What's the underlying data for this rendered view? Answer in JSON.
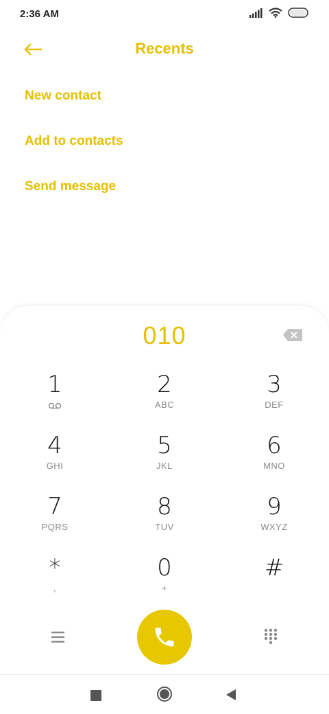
{
  "status_bar": {
    "time": "2:36 AM"
  },
  "header": {
    "title": "Recents"
  },
  "actions": [
    {
      "label": "New contact"
    },
    {
      "label": "Add to contacts"
    },
    {
      "label": "Send message"
    }
  ],
  "dialer": {
    "number": "010",
    "keys": [
      {
        "digit": "1",
        "letters": ""
      },
      {
        "digit": "2",
        "letters": "ABC"
      },
      {
        "digit": "3",
        "letters": "DEF"
      },
      {
        "digit": "4",
        "letters": "GHI"
      },
      {
        "digit": "5",
        "letters": "JKL"
      },
      {
        "digit": "6",
        "letters": "MNO"
      },
      {
        "digit": "7",
        "letters": "PQRS"
      },
      {
        "digit": "8",
        "letters": "TUV"
      },
      {
        "digit": "9",
        "letters": "WXYZ"
      },
      {
        "digit": "*",
        "letters": ","
      },
      {
        "digit": "0",
        "letters": "+"
      },
      {
        "digit": "#",
        "letters": ""
      }
    ]
  },
  "colors": {
    "accent": "#e5c000",
    "call_button": "#e6c700"
  },
  "icons": [
    "signal-icon",
    "wifi-icon",
    "battery-icon",
    "back-arrow-icon",
    "backspace-icon",
    "voicemail-icon",
    "menu-icon",
    "phone-icon",
    "dialpad-icon",
    "nav-recents-icon",
    "nav-home-icon",
    "nav-back-icon"
  ]
}
